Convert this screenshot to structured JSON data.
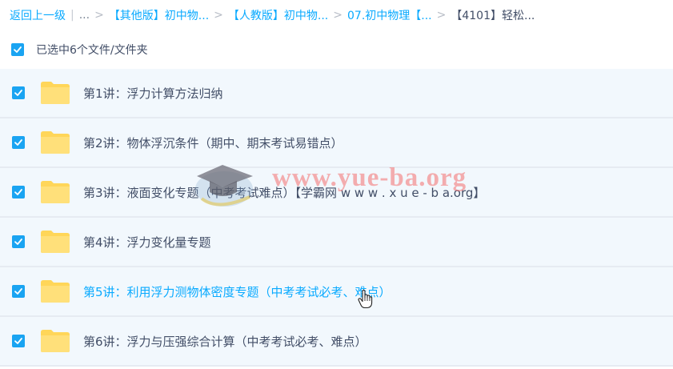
{
  "breadcrumb": {
    "back": "返回上一级",
    "sep_pipe": "|",
    "ellipsis": "...",
    "items": [
      "【其他版】初中物...",
      "【人教版】初中物...",
      "07.初中物理【...",
      "【4101】轻松..."
    ]
  },
  "selection": {
    "label": "已选中6个文件/文件夹"
  },
  "files": [
    {
      "name": "第1讲：浮力计算方法归纳"
    },
    {
      "name": "第2讲：物体浮沉条件（期中、期末考试易错点）"
    },
    {
      "name": "第3讲：液面变化专题（中考考试难点）【学霸网 w w w . x u e - b a.org】"
    },
    {
      "name": "第4讲：浮力变化量专题"
    },
    {
      "name": "第5讲：利用浮力测物体密度专题（中考考试必考、难点）"
    },
    {
      "name": "第6讲：浮力与压强综合计算（中考考试必考、难点）"
    }
  ],
  "watermark": {
    "text": "www.yue-ba.org"
  },
  "icons": {
    "checkbox": "checkbox-checked-icon",
    "folder": "folder-icon",
    "cursor": "hand-pointer-icon"
  },
  "colors": {
    "accent": "#09aaff",
    "checkbox": "#1aa4f2",
    "row_bg": "#f2f8fd",
    "folder": "#ffd659"
  }
}
